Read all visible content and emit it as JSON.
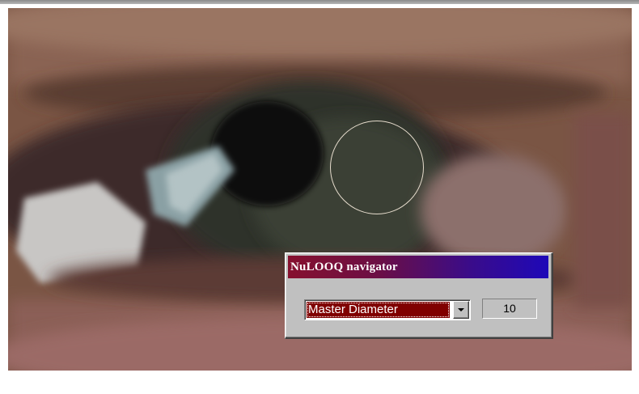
{
  "navigator": {
    "title": "NuLOOQ navigator",
    "parameter": {
      "selected": "Master Diameter",
      "dropdown_icon": "chevron-down-icon"
    },
    "value": "10"
  },
  "colors": {
    "title_bar_start": "#86102f",
    "title_bar_end": "#1e08b8",
    "selection": "#800000",
    "panel": "#c0c0c0",
    "brush_cursor": "#e6dccd"
  }
}
